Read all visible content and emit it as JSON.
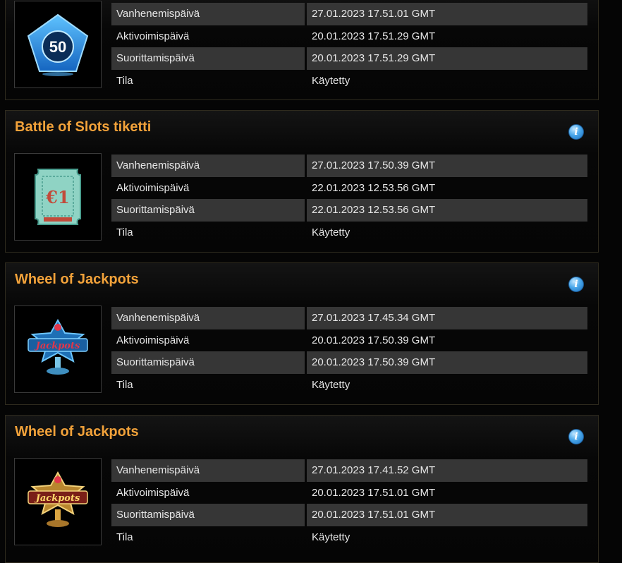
{
  "labels": {
    "expiry": "Vanhenemispäivä",
    "activation": "Aktivoimispäivä",
    "completion": "Suorittamispäivä",
    "status": "Tila"
  },
  "cards": [
    {
      "title": "",
      "icon": "50-badge-icon",
      "expiry": "27.01.2023 17.51.01 GMT",
      "activation": "20.01.2023 17.51.29 GMT",
      "completion": "20.01.2023 17.51.29 GMT",
      "status": "Käytetty"
    },
    {
      "title": "Battle of Slots tiketti",
      "icon": "euro-ticket-icon",
      "expiry": "27.01.2023 17.50.39 GMT",
      "activation": "22.01.2023 12.53.56 GMT",
      "completion": "22.01.2023 12.53.56 GMT",
      "status": "Käytetty"
    },
    {
      "title": "Wheel of Jackpots",
      "icon": "jackpots-blue-icon",
      "expiry": "27.01.2023 17.45.34 GMT",
      "activation": "20.01.2023 17.50.39 GMT",
      "completion": "20.01.2023 17.50.39 GMT",
      "status": "Käytetty"
    },
    {
      "title": "Wheel of Jackpots",
      "icon": "jackpots-gold-icon",
      "expiry": "27.01.2023 17.41.52 GMT",
      "activation": "20.01.2023 17.51.01 GMT",
      "completion": "20.01.2023 17.51.01 GMT",
      "status": "Käytetty"
    }
  ],
  "badge_text": "50",
  "ticket_text": "€1",
  "jackpots_text": "Jackpots",
  "info_glyph": "i",
  "colors": {
    "title": "#f2a23a",
    "row_shade": "#363636",
    "background": "#050505"
  }
}
